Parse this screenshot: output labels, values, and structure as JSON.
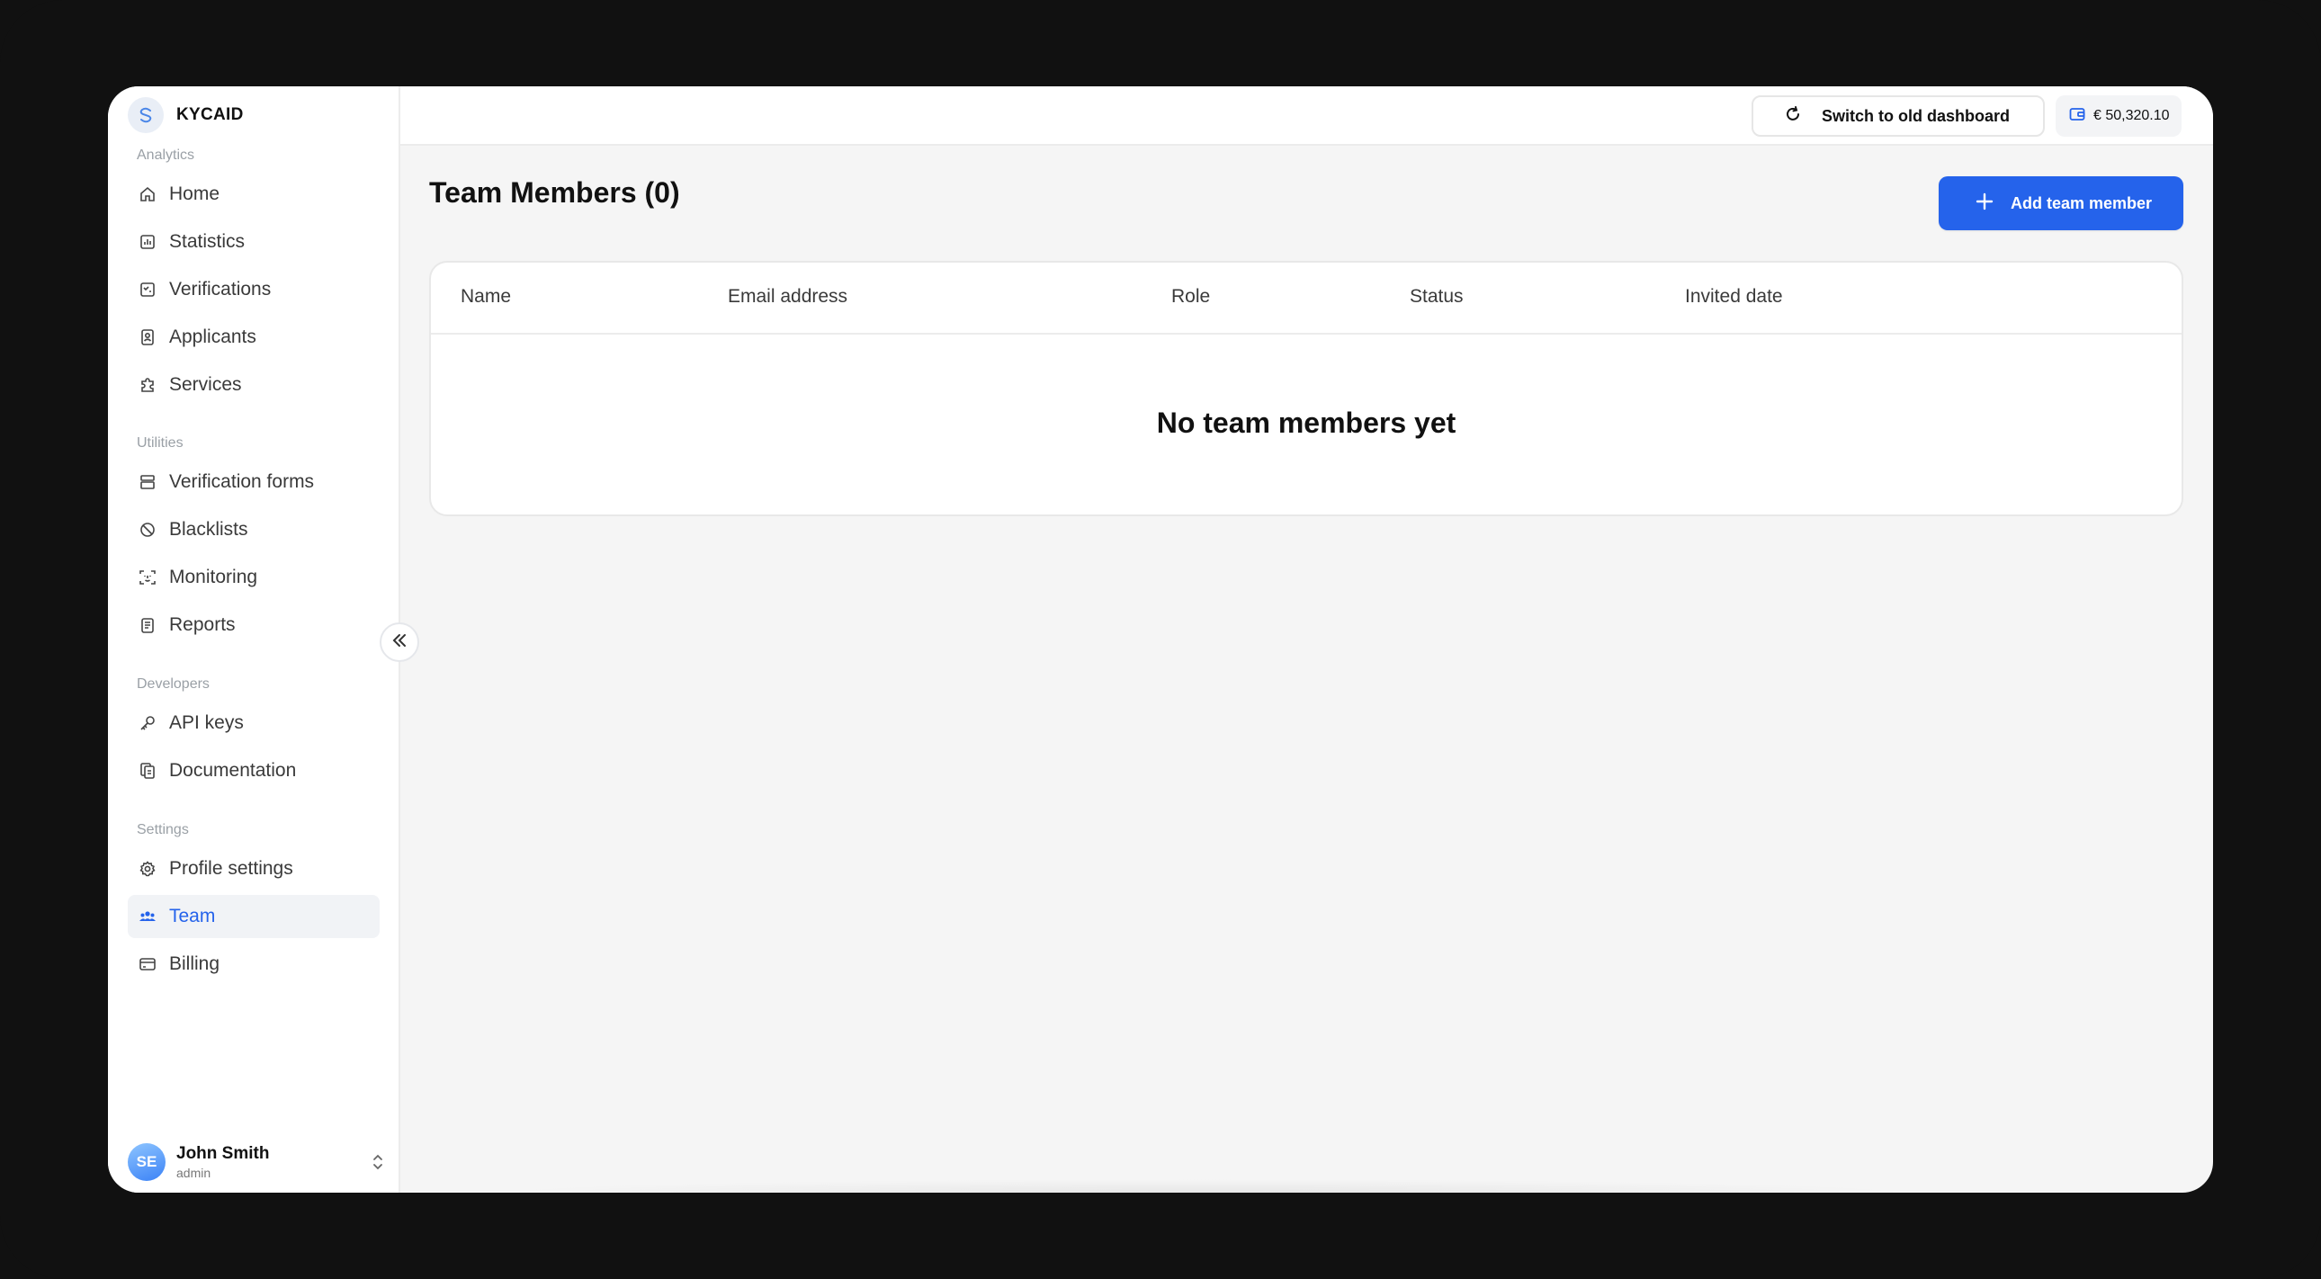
{
  "brand": {
    "name": "KYCAID"
  },
  "sidebar": {
    "sections": [
      {
        "label": "Analytics",
        "items": [
          {
            "label": "Home",
            "icon": "home-icon"
          },
          {
            "label": "Statistics",
            "icon": "chart-icon"
          },
          {
            "label": "Verifications",
            "icon": "checklist-icon"
          },
          {
            "label": "Applicants",
            "icon": "id-card-icon"
          },
          {
            "label": "Services",
            "icon": "puzzle-icon"
          }
        ]
      },
      {
        "label": "Utilities",
        "items": [
          {
            "label": "Verification forms",
            "icon": "forms-icon"
          },
          {
            "label": "Blacklists",
            "icon": "ban-icon"
          },
          {
            "label": "Monitoring",
            "icon": "face-scan-icon"
          },
          {
            "label": "Reports",
            "icon": "clipboard-icon"
          }
        ]
      },
      {
        "label": "Developers",
        "items": [
          {
            "label": "API keys",
            "icon": "key-icon"
          },
          {
            "label": "Documentation",
            "icon": "documents-icon"
          }
        ]
      },
      {
        "label": "Settings",
        "items": [
          {
            "label": "Profile settings",
            "icon": "gear-icon"
          },
          {
            "label": "Team",
            "icon": "team-icon",
            "active": true
          },
          {
            "label": "Billing",
            "icon": "card-icon"
          }
        ]
      }
    ]
  },
  "user": {
    "initials": "SE",
    "name": "John Smith",
    "role": "admin"
  },
  "topbar": {
    "switch_label": "Switch to old dashboard",
    "balance": "€ 50,320.10"
  },
  "main": {
    "title": "Team Members (0)",
    "add_button": "Add team member",
    "table": {
      "columns": [
        "Name",
        "Email address",
        "Role",
        "Status",
        "Invited date"
      ],
      "rows": [],
      "empty_message": "No team members yet"
    }
  },
  "colors": {
    "accent": "#2563eb",
    "frame": "#111111",
    "content_bg": "#f5f5f5"
  }
}
